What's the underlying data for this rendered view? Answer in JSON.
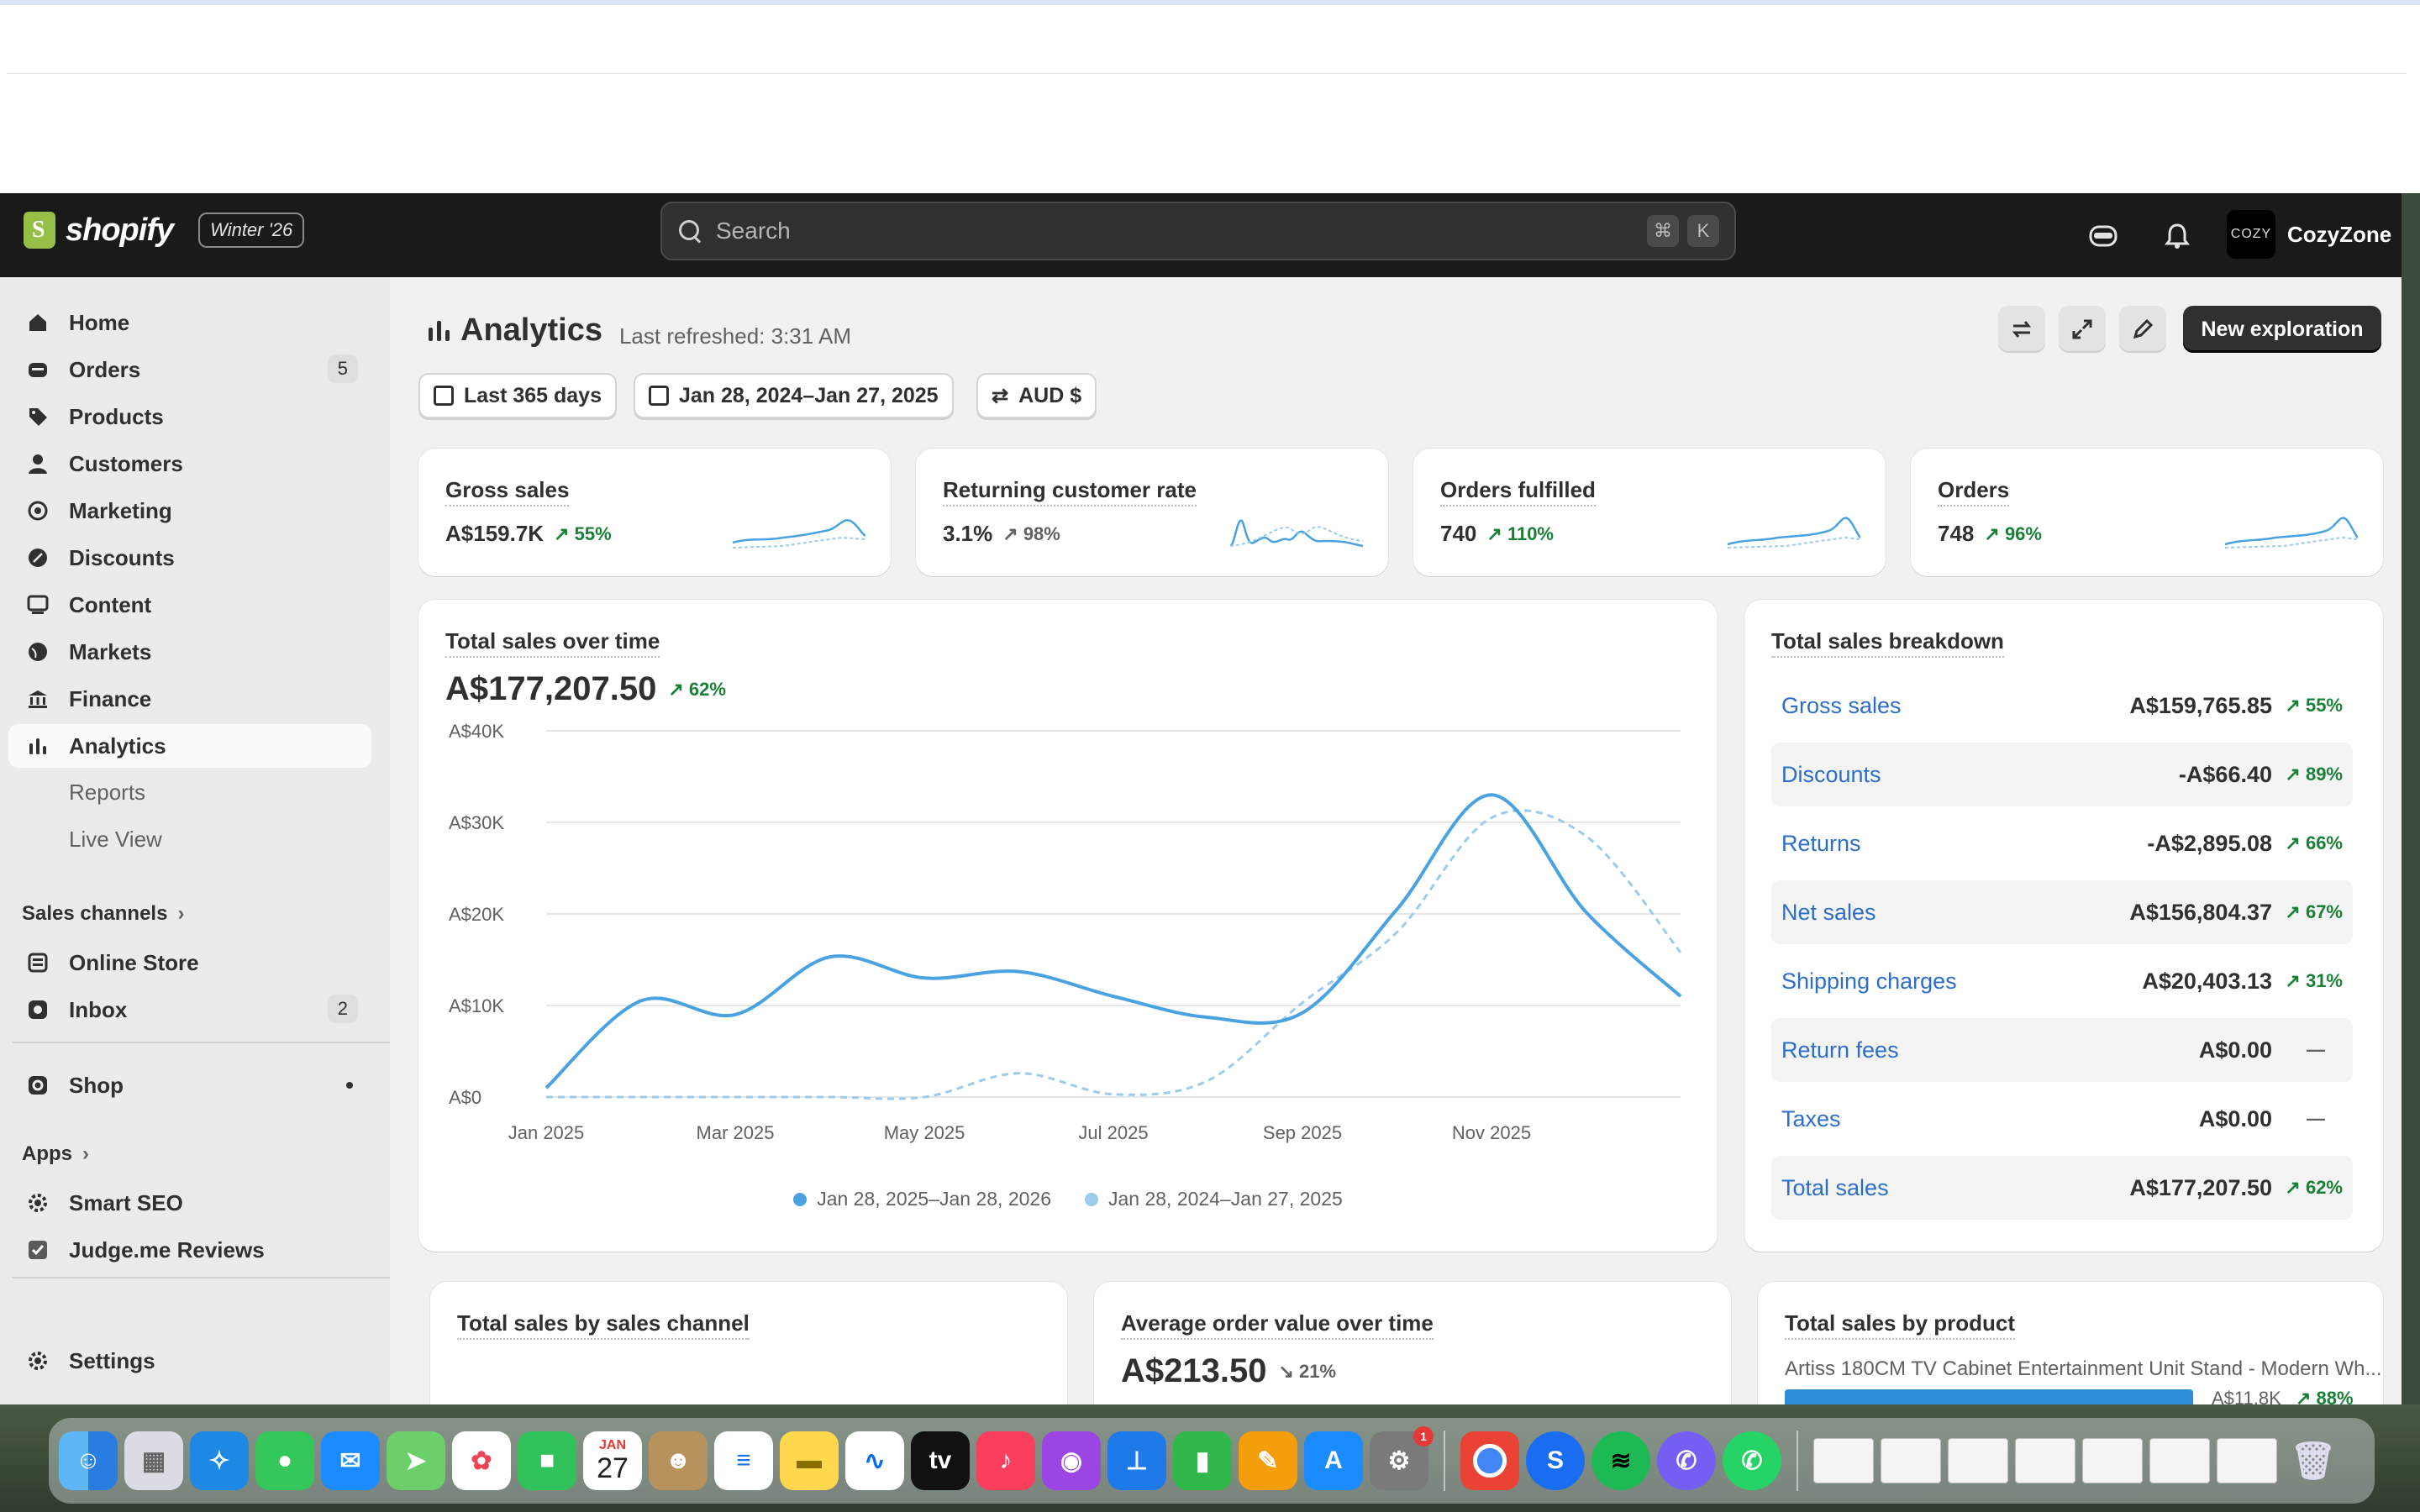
{
  "topbar": {
    "logo_text": "shopify",
    "edition": "Winter '26",
    "search_placeholder": "Search",
    "shortcut_cmd": "⌘",
    "shortcut_key": "K",
    "store_avatar": "COZY",
    "store_name": "CozyZone"
  },
  "sidebar": {
    "items": [
      {
        "label": "Home",
        "icon": "home-icon"
      },
      {
        "label": "Orders",
        "icon": "orders-icon",
        "badge": "5"
      },
      {
        "label": "Products",
        "icon": "tag-icon"
      },
      {
        "label": "Customers",
        "icon": "person-icon"
      },
      {
        "label": "Marketing",
        "icon": "target-icon"
      },
      {
        "label": "Discounts",
        "icon": "discount-icon"
      },
      {
        "label": "Content",
        "icon": "content-icon"
      },
      {
        "label": "Markets",
        "icon": "globe-icon"
      },
      {
        "label": "Finance",
        "icon": "bank-icon"
      },
      {
        "label": "Analytics",
        "icon": "chart-bar-icon"
      }
    ],
    "analytics_sub": [
      "Reports",
      "Live View"
    ],
    "sales_channels_title": "Sales channels",
    "channels": [
      {
        "label": "Online Store",
        "icon": "store-icon"
      },
      {
        "label": "Inbox",
        "icon": "inbox-icon",
        "badge": "2"
      },
      {
        "label": "Shop",
        "icon": "shop-icon"
      }
    ],
    "apps_title": "Apps",
    "apps": [
      {
        "label": "Smart SEO",
        "icon": "gear-icon"
      },
      {
        "label": "Judge.me Reviews",
        "icon": "check-icon"
      }
    ],
    "settings_label": "Settings"
  },
  "header": {
    "title": "Analytics",
    "refreshed": "Last refreshed: 3:31 AM",
    "new_exploration": "New exploration"
  },
  "filters": {
    "period": "Last 365 days",
    "range": "Jan 28, 2024–Jan 27, 2025",
    "currency": "AUD $"
  },
  "kpis": [
    {
      "title": "Gross sales",
      "value": "A$159.7K",
      "delta": "55%",
      "positive": true
    },
    {
      "title": "Returning customer rate",
      "value": "3.1%",
      "delta": "98%",
      "positive": false
    },
    {
      "title": "Orders fulfilled",
      "value": "740",
      "delta": "110%",
      "positive": true
    },
    {
      "title": "Orders",
      "value": "748",
      "delta": "96%",
      "positive": true
    }
  ],
  "sales_over_time": {
    "title": "Total sales over time",
    "total": "A$177,207.50",
    "delta": "62%",
    "legend": [
      "Jan 28, 2025–Jan 28, 2026",
      "Jan 28, 2024–Jan 27, 2025"
    ]
  },
  "chart_data": {
    "type": "line",
    "x": [
      "Jan 2025",
      "Feb 2025",
      "Mar 2025",
      "Apr 2025",
      "May 2025",
      "Jun 2025",
      "Jul 2025",
      "Aug 2025",
      "Sep 2025",
      "Oct 2025",
      "Nov 2025",
      "Dec 2025",
      "Jan 2026"
    ],
    "xticks": [
      "Jan 2025",
      "Mar 2025",
      "May 2025",
      "Jul 2025",
      "Sep 2025",
      "Nov 2025"
    ],
    "yticks": [
      "A$0",
      "A$10K",
      "A$20K",
      "A$30K",
      "A$40K"
    ],
    "ylim": [
      0,
      40000
    ],
    "series": [
      {
        "name": "Jan 28, 2025–Jan 28, 2026",
        "color": "#4aa3e0",
        "dashed": false,
        "values": [
          1000,
          10500,
          9000,
          15300,
          13000,
          13700,
          11000,
          8700,
          9200,
          20500,
          33000,
          20200,
          11000
        ]
      },
      {
        "name": "Jan 28, 2024–Jan 27, 2025",
        "color": "#9ccbeb",
        "dashed": true,
        "values": [
          0,
          0,
          0,
          0,
          0,
          2600,
          300,
          1800,
          10300,
          18000,
          30500,
          28500,
          15800
        ]
      }
    ],
    "grid": true
  },
  "breakdown": {
    "title": "Total sales breakdown",
    "rows": [
      {
        "label": "Gross sales",
        "value": "A$159,765.85",
        "delta": "55%"
      },
      {
        "label": "Discounts",
        "value": "-A$66.40",
        "delta": "89%"
      },
      {
        "label": "Returns",
        "value": "-A$2,895.08",
        "delta": "66%"
      },
      {
        "label": "Net sales",
        "value": "A$156,804.37",
        "delta": "67%"
      },
      {
        "label": "Shipping charges",
        "value": "A$20,403.13",
        "delta": "31%"
      },
      {
        "label": "Return fees",
        "value": "A$0.00",
        "delta": "—"
      },
      {
        "label": "Taxes",
        "value": "A$0.00",
        "delta": "—"
      },
      {
        "label": "Total sales",
        "value": "A$177,207.50",
        "delta": "62%"
      }
    ]
  },
  "bottom_cards": {
    "by_channel_title": "Total sales by sales channel",
    "aov_title": "Average order value over time",
    "aov_value": "A$213.50",
    "aov_delta": "21%",
    "by_product_title": "Total sales by product",
    "product_name": "Artiss 180CM TV Cabinet Entertainment Unit Stand - Modern Wh...",
    "product_value": "A$11.8K",
    "product_delta": "88%"
  },
  "dock": {
    "calendar_month": "JAN",
    "calendar_day": "27",
    "notification_badge": "1"
  }
}
